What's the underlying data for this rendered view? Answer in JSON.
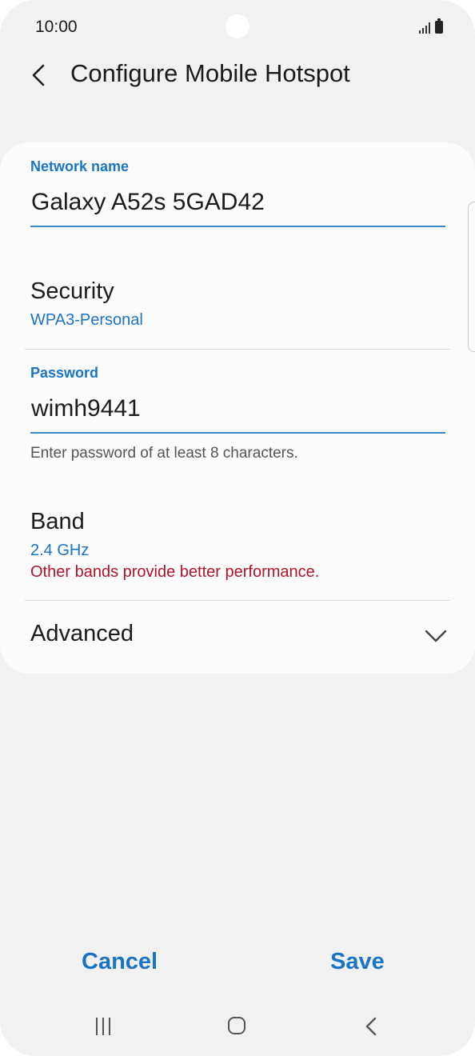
{
  "status_bar": {
    "time": "10:00",
    "signal_icon": "signal-icon",
    "battery_icon": "battery-icon"
  },
  "header": {
    "title": "Configure Mobile Hotspot",
    "back_icon": "back-arrow-icon"
  },
  "form": {
    "network_name": {
      "label": "Network name",
      "value": "Galaxy A52s 5GAD42"
    },
    "security": {
      "title": "Security",
      "value": "WPA3-Personal"
    },
    "password": {
      "label": "Password",
      "value": "wimh9441",
      "helper": "Enter password of at least 8 characters."
    },
    "band": {
      "title": "Band",
      "value": "2.4 GHz",
      "warning": "Other bands provide better performance."
    },
    "advanced": {
      "title": "Advanced",
      "icon": "chevron-down-icon"
    }
  },
  "actions": {
    "cancel": "Cancel",
    "save": "Save"
  },
  "nav_bar": {
    "recent": "recent-apps-icon",
    "home": "home-icon",
    "back": "back-icon"
  },
  "colors": {
    "accent": "#1a74c6",
    "warning": "#b2132b",
    "background": "#f1f1f1",
    "card": "#fcfcfc"
  }
}
